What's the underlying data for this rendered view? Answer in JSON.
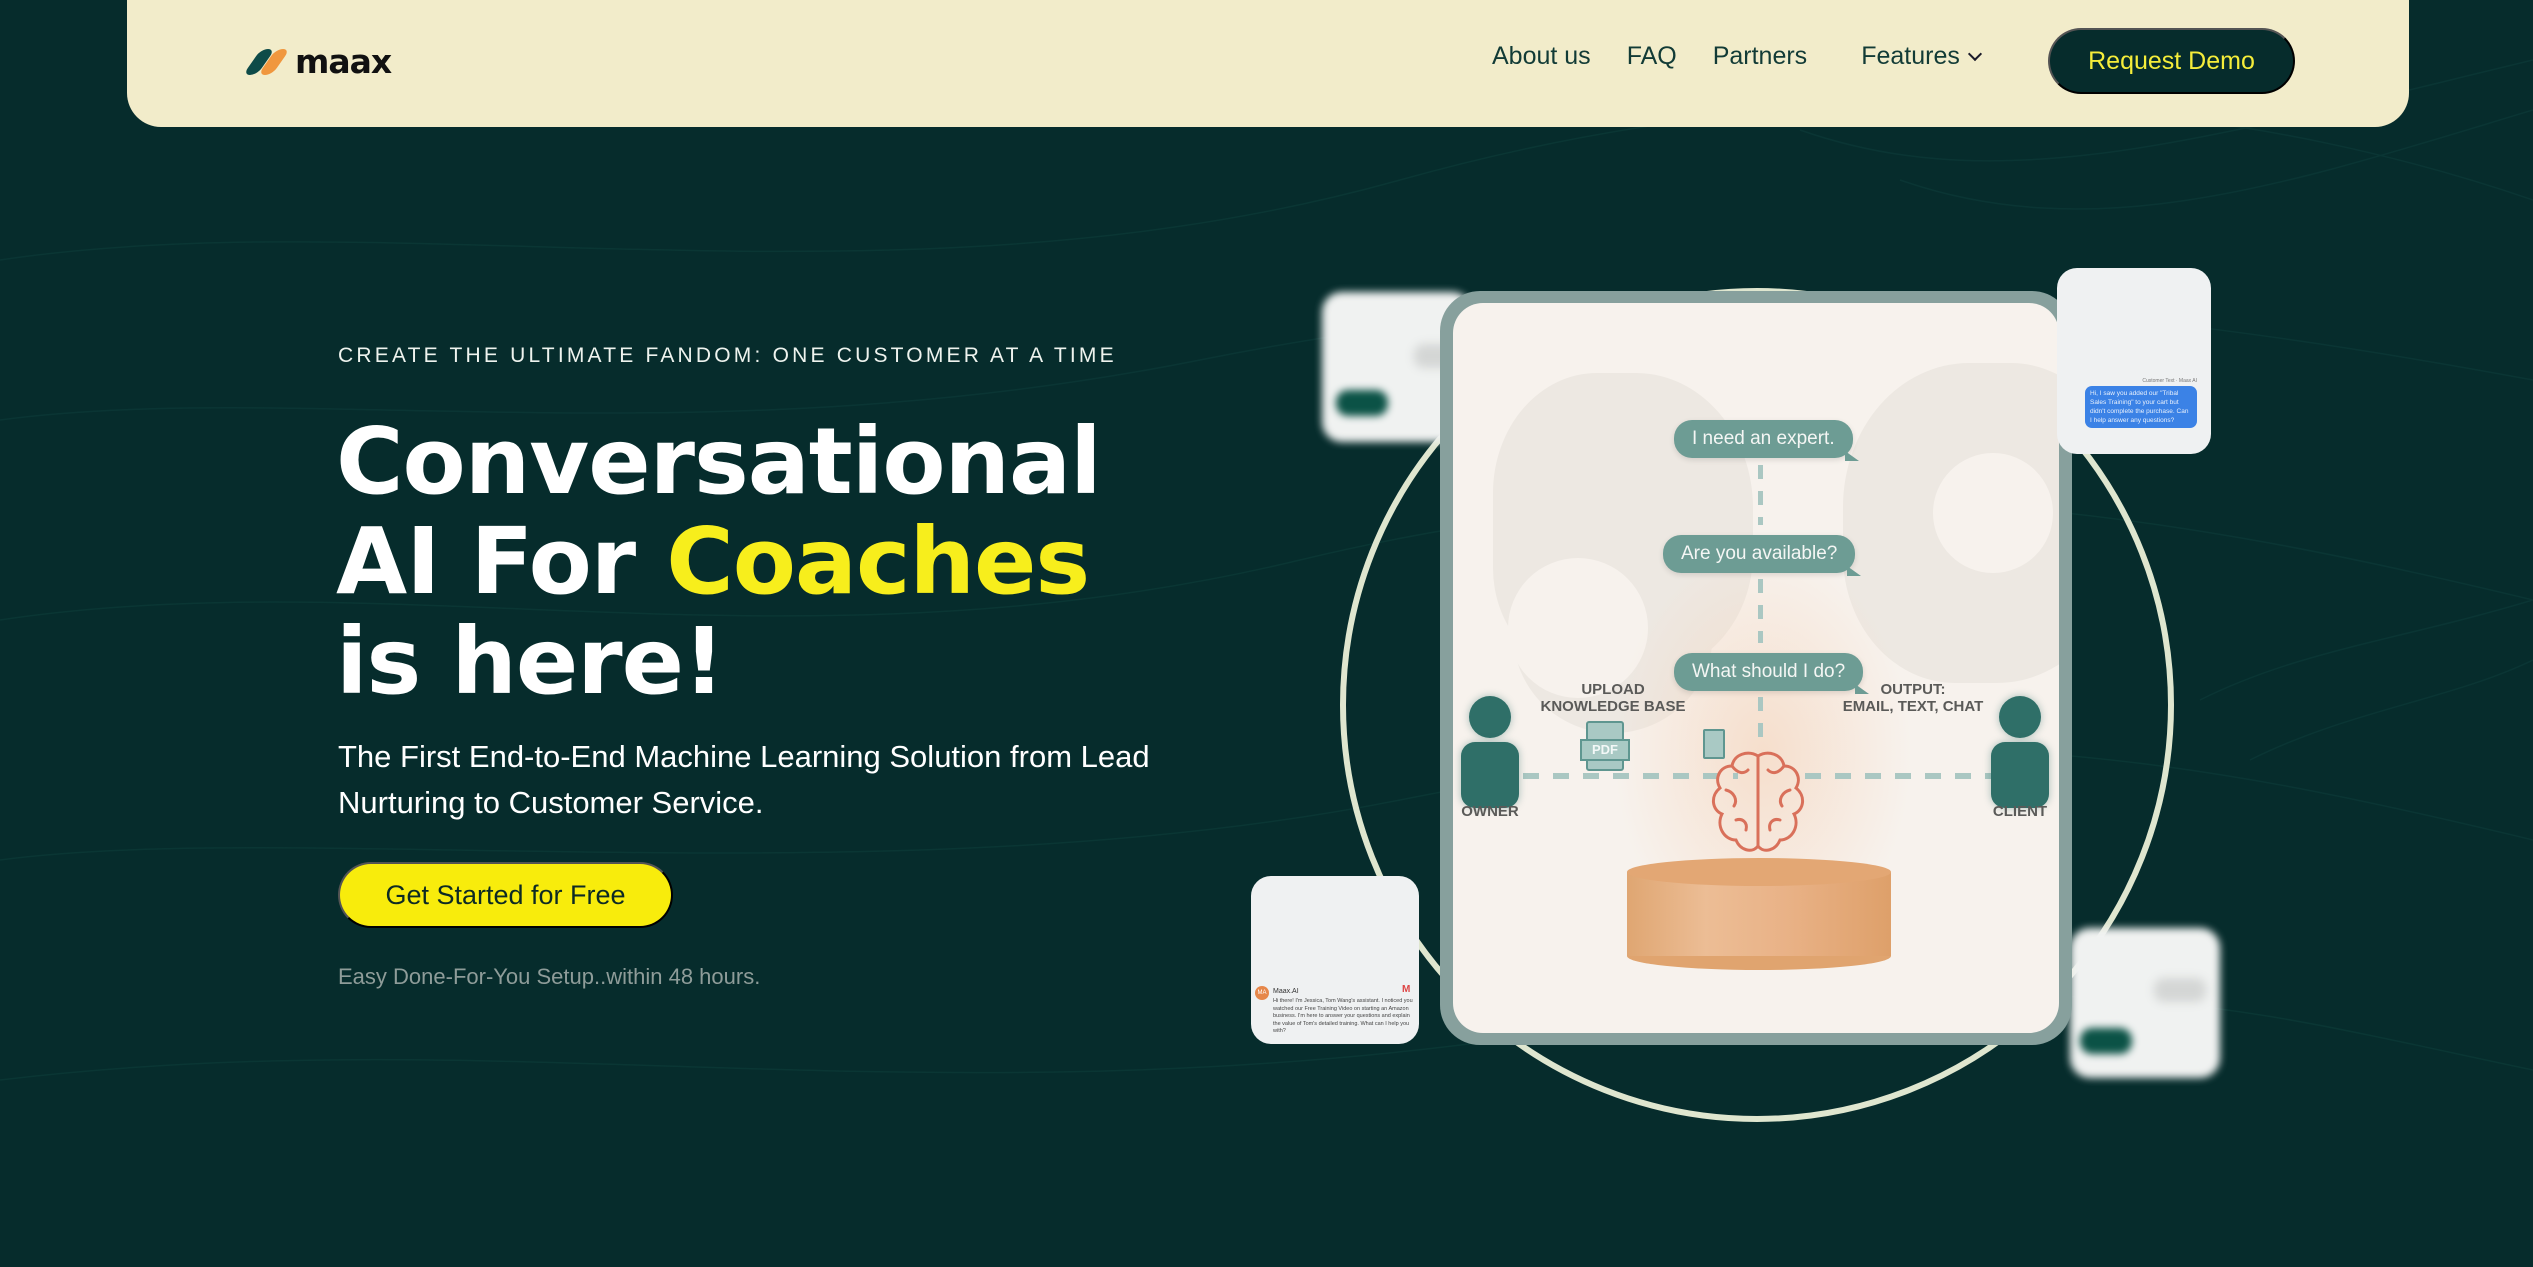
{
  "brand": {
    "name": "maax",
    "colors": {
      "primary": "#062c2c",
      "accent": "#f8ec0c",
      "nav_bg": "#f2ecca",
      "logo_teal": "#0e4b48",
      "logo_orange": "#f0973e"
    }
  },
  "nav": {
    "links": [
      {
        "label": "About us"
      },
      {
        "label": "FAQ"
      },
      {
        "label": "Partners"
      },
      {
        "label": "Features",
        "icon": "chevron-down-icon"
      }
    ],
    "cta_label": "Request Demo"
  },
  "hero": {
    "eyebrow": "CREATE THE ULTIMATE FANDOM: ONE CUSTOMER AT A TIME",
    "headline_line1": "Conversational",
    "headline_line2_prefix": "AI For ",
    "headline_highlight": "Coaches",
    "headline_line3": "is here!",
    "subheadline": "The First End-to-End Machine Learning Solution from Lead Nurturing to Customer Service.",
    "cta_label": "Get Started for Free",
    "note": "Easy Done-For-You Setup..within 48 hours."
  },
  "illustration": {
    "bubbles": [
      "I need an expert.",
      "Are you available?",
      "What should I do?"
    ],
    "upload_label_1": "UPLOAD",
    "upload_label_2": "KNOWLEDGE BASE",
    "output_label_1": "OUTPUT:",
    "output_label_2": "EMAIL, TEXT, CHAT",
    "owner_label": "OWNER",
    "client_label": "CLIENT",
    "pdf_label": "PDF"
  },
  "sms_card": {
    "meta": "Customer Text · Maax AI",
    "message": "Hi, I saw you added our \"Tribal Sales Training\" to your cart but didn't complete the purchase. Can I help answer any questions?"
  },
  "email_card": {
    "avatar_initials": "MA",
    "sender": "Maax.AI",
    "message": "Hi there! I'm Jessica, Tom Wang's assistant. I noticed you watched our Free Training Video on starting an Amazon business. I'm here to answer your questions and explain the value of Tom's detailed training. What can I help you with?"
  }
}
